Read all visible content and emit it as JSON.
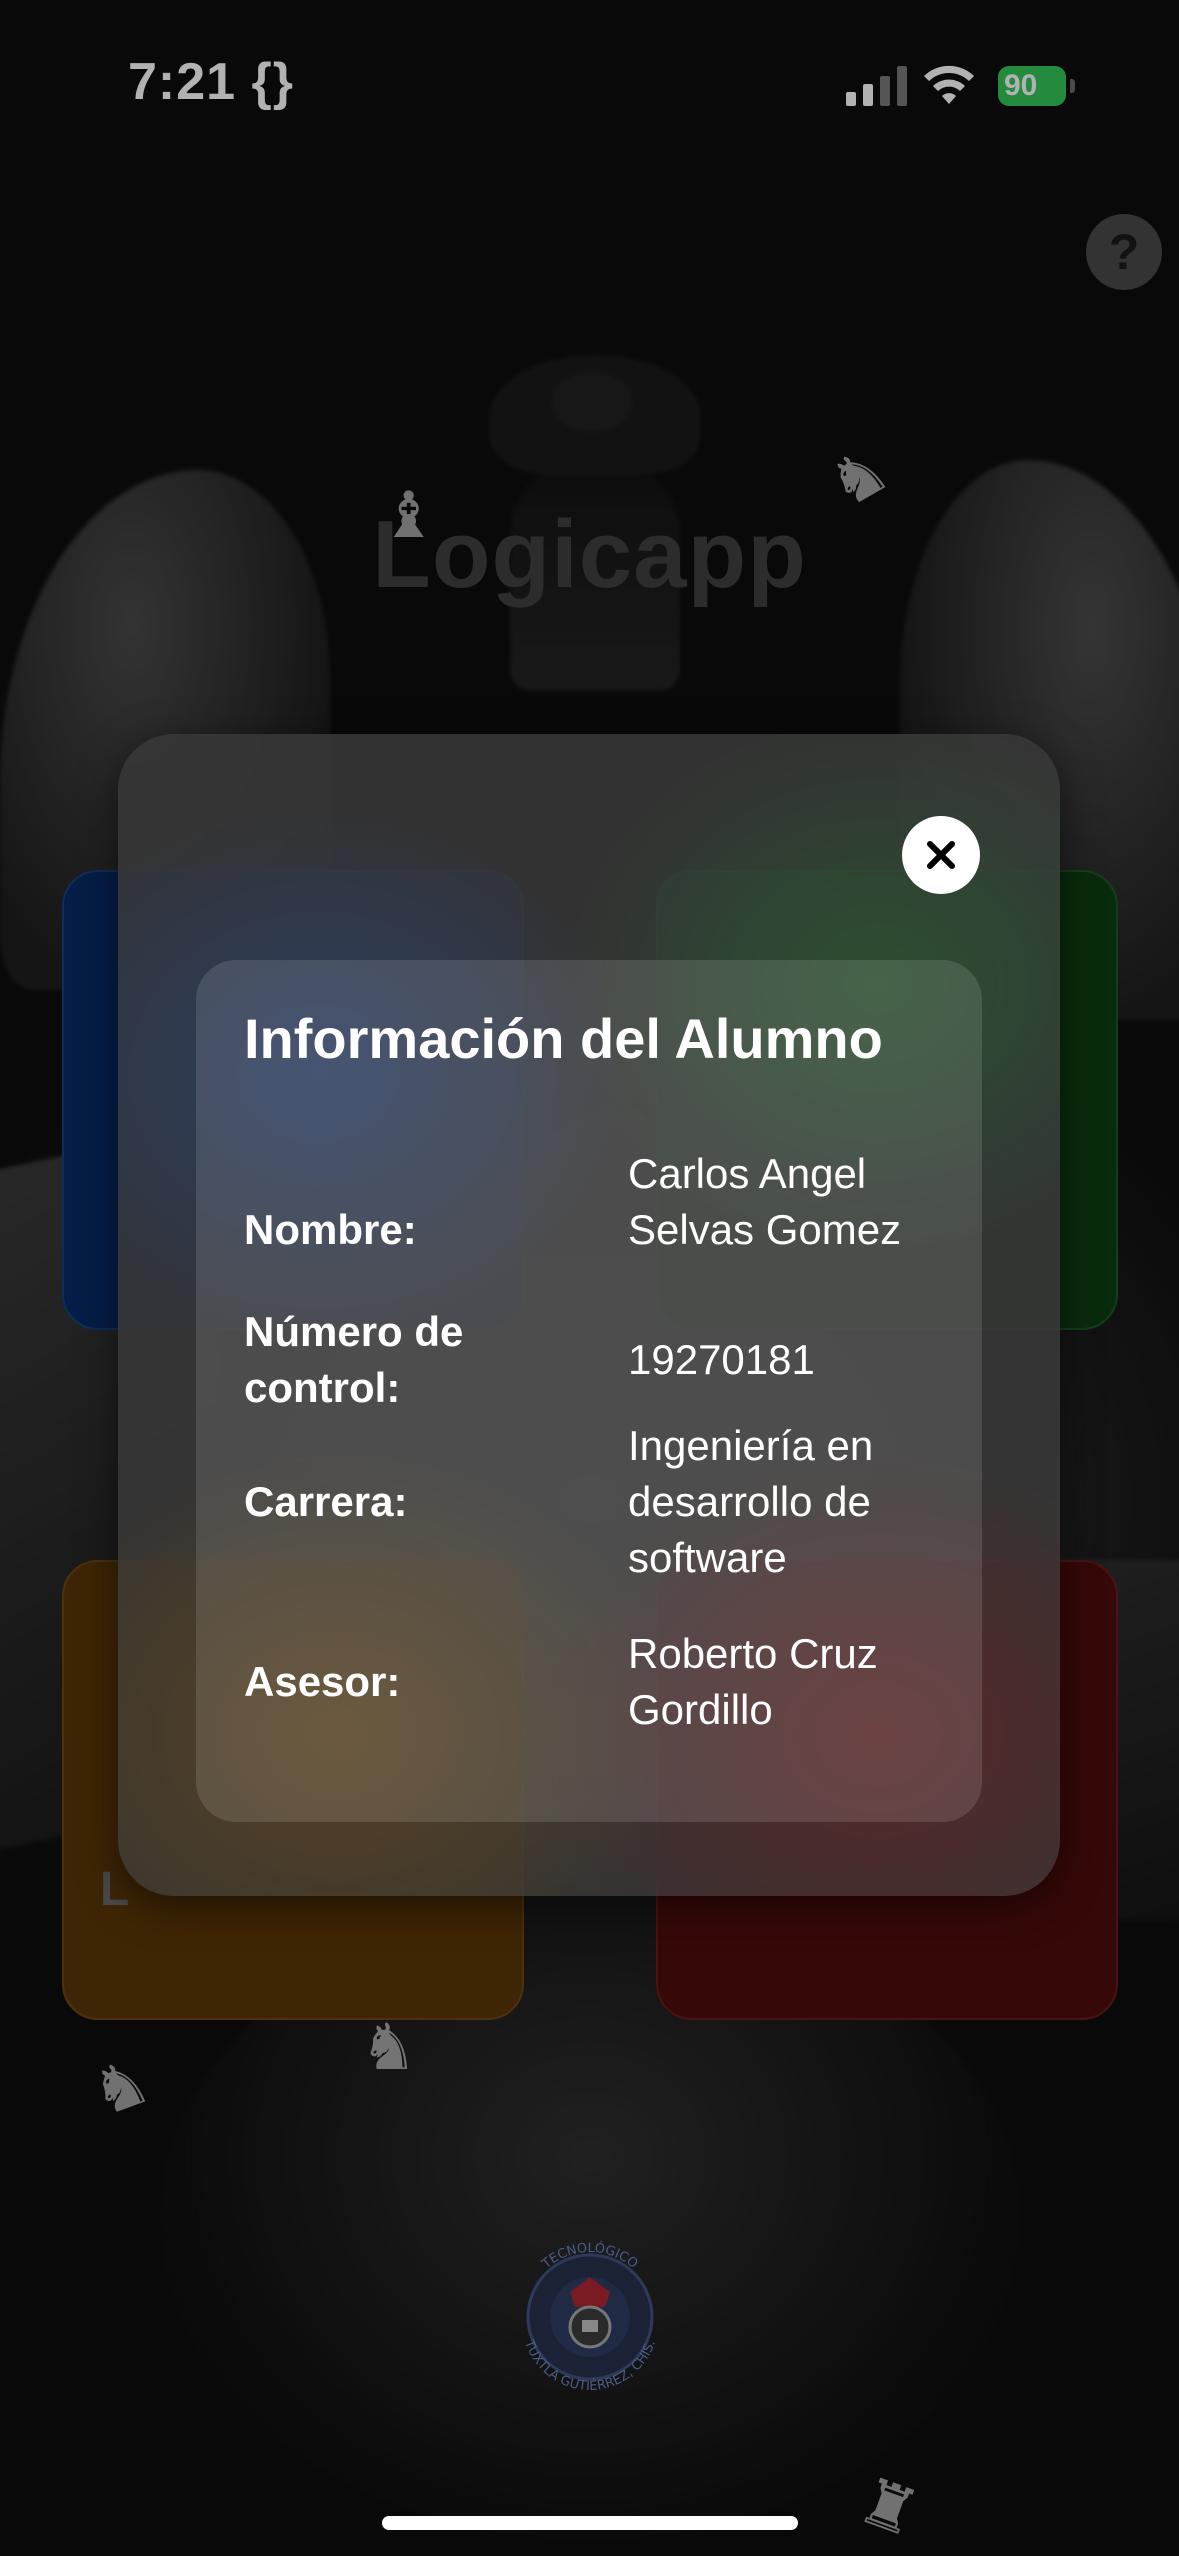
{
  "status_bar": {
    "time": "7:21 {}",
    "battery": "90"
  },
  "app": {
    "title": "Logicapp",
    "help_label": "?"
  },
  "menu_cards": {
    "orange_label_partial": "L"
  },
  "modal": {
    "title": "Información del Alumno",
    "close_icon": "close-icon",
    "fields": [
      {
        "label": "Nombre:",
        "value": "Carlos Angel Selvas Gomez"
      },
      {
        "label": "Número de control:",
        "value": "19270181"
      },
      {
        "label": "Carrera:",
        "value": "Ingeniería en desarrollo de software"
      },
      {
        "label": "Asesor:",
        "value": "Roberto Cruz Gordillo"
      }
    ]
  },
  "logo": {
    "text": "TECNOLÓGICO TUXTLA GUTIÉRREZ, CHIS."
  },
  "colors": {
    "blue_card": "#0a2a66",
    "green_card": "#0d3e14",
    "orange_card": "#5a3608",
    "red_card": "#4e0c0c",
    "battery": "#34c759"
  }
}
